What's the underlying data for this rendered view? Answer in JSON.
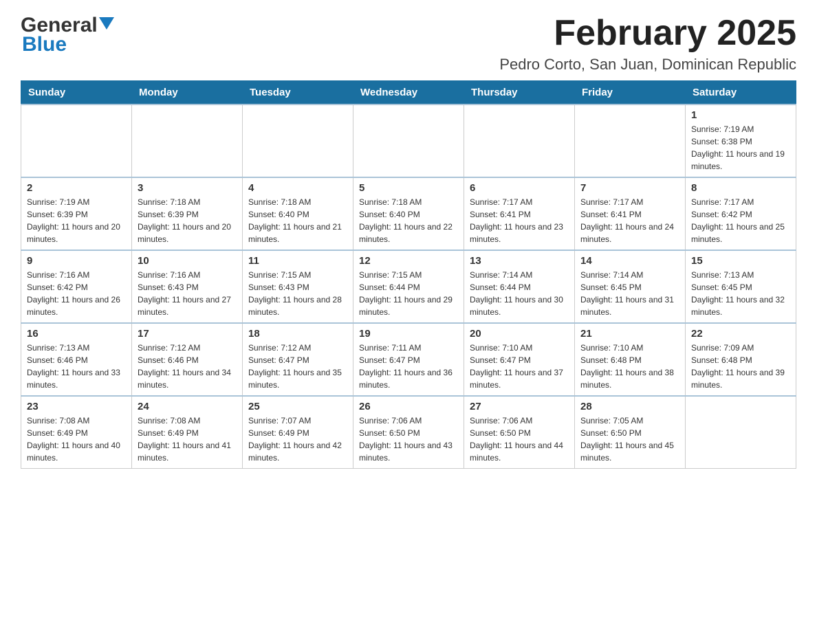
{
  "header": {
    "logo_general": "General",
    "logo_blue": "Blue",
    "month_title": "February 2025",
    "location": "Pedro Corto, San Juan, Dominican Republic"
  },
  "weekdays": [
    "Sunday",
    "Monday",
    "Tuesday",
    "Wednesday",
    "Thursday",
    "Friday",
    "Saturday"
  ],
  "weeks": [
    [
      {
        "day": "",
        "info": ""
      },
      {
        "day": "",
        "info": ""
      },
      {
        "day": "",
        "info": ""
      },
      {
        "day": "",
        "info": ""
      },
      {
        "day": "",
        "info": ""
      },
      {
        "day": "",
        "info": ""
      },
      {
        "day": "1",
        "info": "Sunrise: 7:19 AM\nSunset: 6:38 PM\nDaylight: 11 hours and 19 minutes."
      }
    ],
    [
      {
        "day": "2",
        "info": "Sunrise: 7:19 AM\nSunset: 6:39 PM\nDaylight: 11 hours and 20 minutes."
      },
      {
        "day": "3",
        "info": "Sunrise: 7:18 AM\nSunset: 6:39 PM\nDaylight: 11 hours and 20 minutes."
      },
      {
        "day": "4",
        "info": "Sunrise: 7:18 AM\nSunset: 6:40 PM\nDaylight: 11 hours and 21 minutes."
      },
      {
        "day": "5",
        "info": "Sunrise: 7:18 AM\nSunset: 6:40 PM\nDaylight: 11 hours and 22 minutes."
      },
      {
        "day": "6",
        "info": "Sunrise: 7:17 AM\nSunset: 6:41 PM\nDaylight: 11 hours and 23 minutes."
      },
      {
        "day": "7",
        "info": "Sunrise: 7:17 AM\nSunset: 6:41 PM\nDaylight: 11 hours and 24 minutes."
      },
      {
        "day": "8",
        "info": "Sunrise: 7:17 AM\nSunset: 6:42 PM\nDaylight: 11 hours and 25 minutes."
      }
    ],
    [
      {
        "day": "9",
        "info": "Sunrise: 7:16 AM\nSunset: 6:42 PM\nDaylight: 11 hours and 26 minutes."
      },
      {
        "day": "10",
        "info": "Sunrise: 7:16 AM\nSunset: 6:43 PM\nDaylight: 11 hours and 27 minutes."
      },
      {
        "day": "11",
        "info": "Sunrise: 7:15 AM\nSunset: 6:43 PM\nDaylight: 11 hours and 28 minutes."
      },
      {
        "day": "12",
        "info": "Sunrise: 7:15 AM\nSunset: 6:44 PM\nDaylight: 11 hours and 29 minutes."
      },
      {
        "day": "13",
        "info": "Sunrise: 7:14 AM\nSunset: 6:44 PM\nDaylight: 11 hours and 30 minutes."
      },
      {
        "day": "14",
        "info": "Sunrise: 7:14 AM\nSunset: 6:45 PM\nDaylight: 11 hours and 31 minutes."
      },
      {
        "day": "15",
        "info": "Sunrise: 7:13 AM\nSunset: 6:45 PM\nDaylight: 11 hours and 32 minutes."
      }
    ],
    [
      {
        "day": "16",
        "info": "Sunrise: 7:13 AM\nSunset: 6:46 PM\nDaylight: 11 hours and 33 minutes."
      },
      {
        "day": "17",
        "info": "Sunrise: 7:12 AM\nSunset: 6:46 PM\nDaylight: 11 hours and 34 minutes."
      },
      {
        "day": "18",
        "info": "Sunrise: 7:12 AM\nSunset: 6:47 PM\nDaylight: 11 hours and 35 minutes."
      },
      {
        "day": "19",
        "info": "Sunrise: 7:11 AM\nSunset: 6:47 PM\nDaylight: 11 hours and 36 minutes."
      },
      {
        "day": "20",
        "info": "Sunrise: 7:10 AM\nSunset: 6:47 PM\nDaylight: 11 hours and 37 minutes."
      },
      {
        "day": "21",
        "info": "Sunrise: 7:10 AM\nSunset: 6:48 PM\nDaylight: 11 hours and 38 minutes."
      },
      {
        "day": "22",
        "info": "Sunrise: 7:09 AM\nSunset: 6:48 PM\nDaylight: 11 hours and 39 minutes."
      }
    ],
    [
      {
        "day": "23",
        "info": "Sunrise: 7:08 AM\nSunset: 6:49 PM\nDaylight: 11 hours and 40 minutes."
      },
      {
        "day": "24",
        "info": "Sunrise: 7:08 AM\nSunset: 6:49 PM\nDaylight: 11 hours and 41 minutes."
      },
      {
        "day": "25",
        "info": "Sunrise: 7:07 AM\nSunset: 6:49 PM\nDaylight: 11 hours and 42 minutes."
      },
      {
        "day": "26",
        "info": "Sunrise: 7:06 AM\nSunset: 6:50 PM\nDaylight: 11 hours and 43 minutes."
      },
      {
        "day": "27",
        "info": "Sunrise: 7:06 AM\nSunset: 6:50 PM\nDaylight: 11 hours and 44 minutes."
      },
      {
        "day": "28",
        "info": "Sunrise: 7:05 AM\nSunset: 6:50 PM\nDaylight: 11 hours and 45 minutes."
      },
      {
        "day": "",
        "info": ""
      }
    ]
  ]
}
